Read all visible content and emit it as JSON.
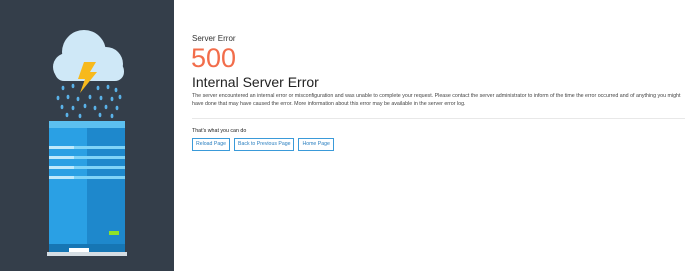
{
  "error": {
    "eyebrow": "Server Error",
    "code": "500",
    "headline": "Internal Server Error",
    "description": "The server encountered an internal error or misconfiguration and was unable to complete your request. Please contact the server administrator to inform of the time the error occurred and of anything you might have done that may have caused the error. More information about this error may be available in the server error log."
  },
  "actions": {
    "title": "That's what you can do",
    "reload_label": "Reload Page",
    "back_label": "Back to Previous Page",
    "home_label": "Home Page"
  },
  "illustration": {
    "icons": [
      "cloud-icon",
      "lightning-bolt-icon",
      "rain-icon",
      "server-icon",
      "status-led-icon"
    ],
    "colors": {
      "panel": "#343e4a",
      "cloud": "#cfe8f7",
      "bolt": "#f7b91c",
      "rain": "#5ab2e8",
      "server": "#1e88cc",
      "led": "#8ee22a",
      "accent": "#f26d4b"
    }
  }
}
